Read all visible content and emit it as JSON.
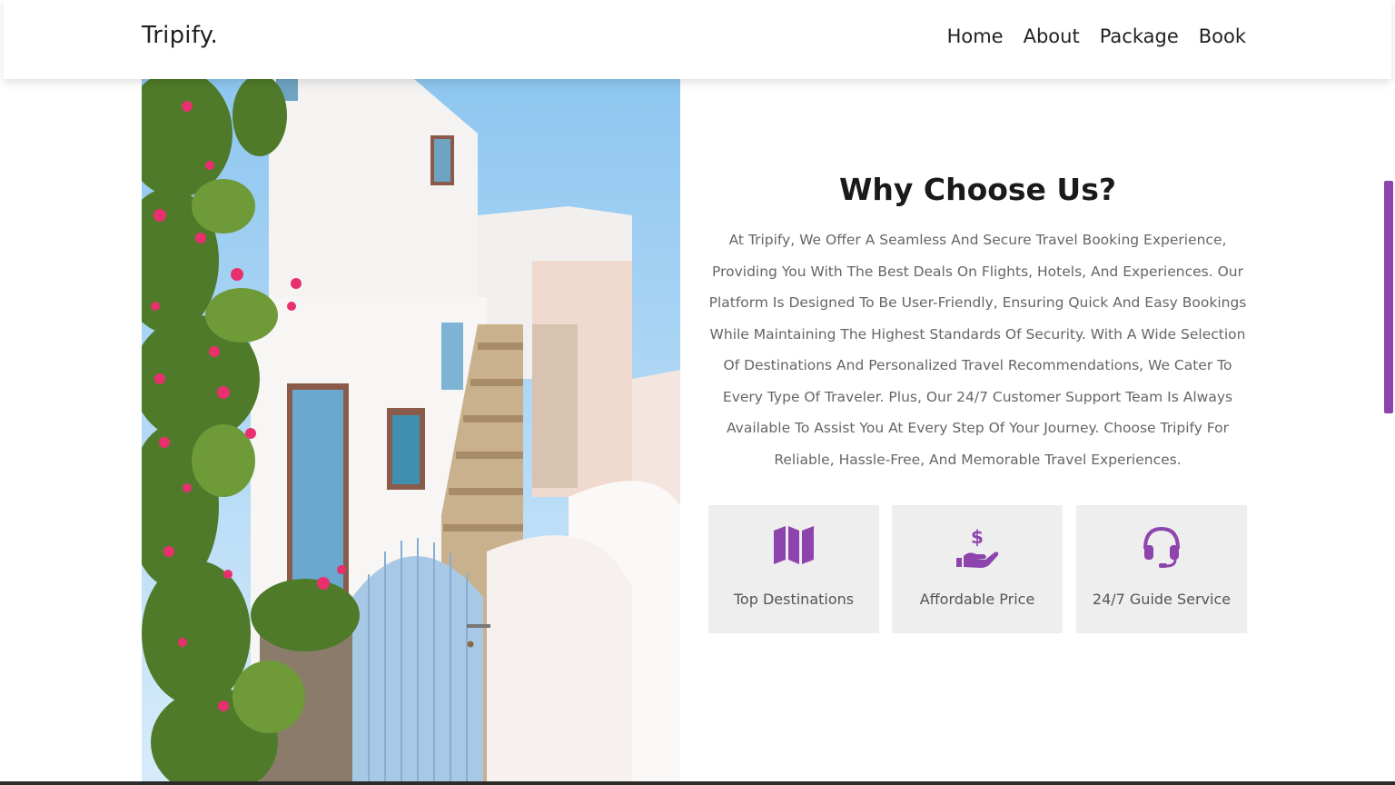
{
  "brand": {
    "name": "Tripify."
  },
  "nav": {
    "items": [
      "Home",
      "About",
      "Package",
      "Book"
    ]
  },
  "section": {
    "title": "Why Choose Us?",
    "description": "At Tripify, We Offer A Seamless And Secure Travel Booking Experience, Providing You With The Best Deals On Flights, Hotels, And Experiences. Our Platform Is Designed To Be User-Friendly, Ensuring Quick And Easy Bookings While Maintaining The Highest Standards Of Security. With A Wide Selection Of Destinations And Personalized Travel Recommendations, We Cater To Every Type Of Traveler. Plus, Our 24/7 Customer Support Team Is Always Available To Assist You At Every Step Of Your Journey. Choose Tripify For Reliable, Hassle-Free, And Memorable Travel Experiences."
  },
  "features": [
    {
      "label": "Top Destinations",
      "icon": "map-icon"
    },
    {
      "label": "Affordable Price",
      "icon": "hand-dollar-icon"
    },
    {
      "label": "24/7 Guide Service",
      "icon": "headset-icon"
    }
  ],
  "colors": {
    "accent": "#8e44ad",
    "card_bg": "#eeeeee",
    "text_dark": "#1a1a1a",
    "text_muted": "#666666"
  }
}
